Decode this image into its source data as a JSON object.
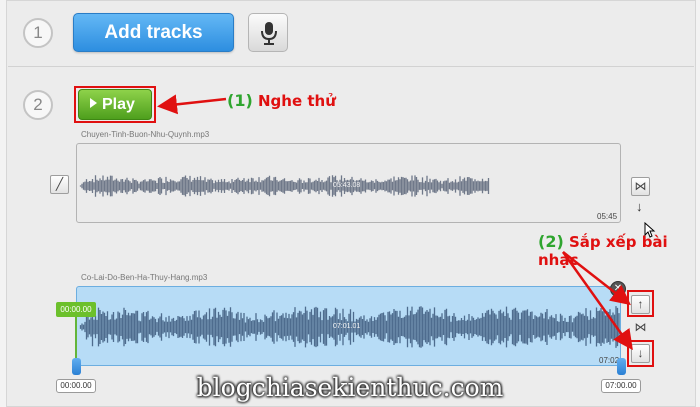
{
  "step1": {
    "number": "1",
    "add_tracks_label": "Add tracks"
  },
  "step2": {
    "number": "2",
    "play_label": "Play"
  },
  "annotations": {
    "a1_num": "(1)",
    "a1_text": "Nghe thử",
    "a2_num": "(2)",
    "a2_text": "Sắp xếp bài nhạc"
  },
  "tracks": [
    {
      "filename": "Chuyen-Tinh-Buon-Nhu-Quynh.mp3",
      "center_time": "05:43.08",
      "end_time": "05:45"
    },
    {
      "filename": "Co-Lai-Do-Ben-Ha-Thuy-Hang.mp3",
      "center_time": "07:01.01",
      "end_time": "07:02",
      "start_tag": "00:00.00",
      "start_box": "00:00.00",
      "end_box": "07:00.00"
    }
  ],
  "icons": {
    "mic": "microphone-icon",
    "edit": "pencil-icon",
    "swap": "bowtie-icon",
    "up": "arrow-up-icon",
    "down": "arrow-down-icon",
    "close": "close-icon"
  },
  "watermark": "blogchiasekienthuc.com"
}
